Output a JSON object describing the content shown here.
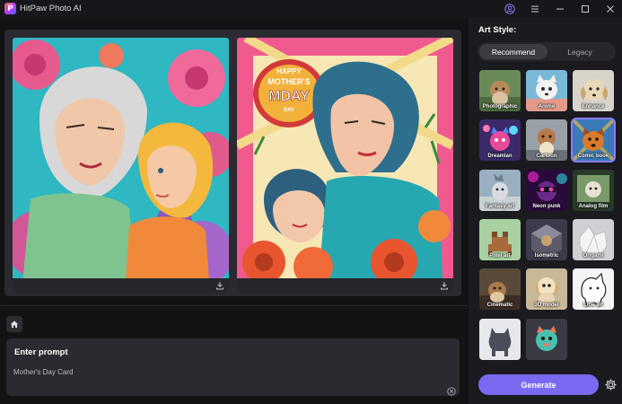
{
  "app": {
    "title": "HitPaw Photo AI",
    "logo_letter": "P",
    "accent": "#7a6af2"
  },
  "titlebar_icons": [
    "user-icon",
    "menu-icon",
    "minimize-icon",
    "maximize-icon",
    "close-icon"
  ],
  "canvas": {
    "images": [
      {
        "name": "generated-image-1",
        "icon": "download-icon"
      },
      {
        "name": "generated-image-2",
        "icon": "download-icon",
        "poster_text_1": "HAPPY",
        "poster_text_2": "MOTHER'S",
        "poster_text_3": "MDAY",
        "poster_text_4": "DAY"
      }
    ]
  },
  "prompt": {
    "title": "Enter prompt",
    "value": "Mother's Day Card",
    "placeholder": ""
  },
  "art_style": {
    "label": "Art Style:",
    "tabs": [
      {
        "label": "Recommend",
        "active": true
      },
      {
        "label": "Legacy",
        "active": false
      }
    ],
    "styles": [
      {
        "label": "Photographic",
        "selected": false
      },
      {
        "label": "Anime",
        "selected": false
      },
      {
        "label": "Enhance",
        "selected": false
      },
      {
        "label": "Dreamlan",
        "selected": false
      },
      {
        "label": "Cartoon",
        "selected": false
      },
      {
        "label": "Comic book",
        "selected": true
      },
      {
        "label": "Fantasy art",
        "selected": false
      },
      {
        "label": "Neon punk",
        "selected": false
      },
      {
        "label": "Analog film",
        "selected": false
      },
      {
        "label": "Pixel art",
        "selected": false
      },
      {
        "label": "Isometric",
        "selected": false
      },
      {
        "label": "Origami",
        "selected": false
      },
      {
        "label": "Cinematic",
        "selected": false
      },
      {
        "label": "3D model",
        "selected": false
      },
      {
        "label": "Line art",
        "selected": false
      },
      {
        "label": "",
        "selected": false
      },
      {
        "label": "",
        "selected": false
      }
    ]
  },
  "actions": {
    "generate_label": "Generate",
    "settings_icon": "gear-icon",
    "home_icon": "home-icon",
    "clear_icon": "clear-icon"
  }
}
